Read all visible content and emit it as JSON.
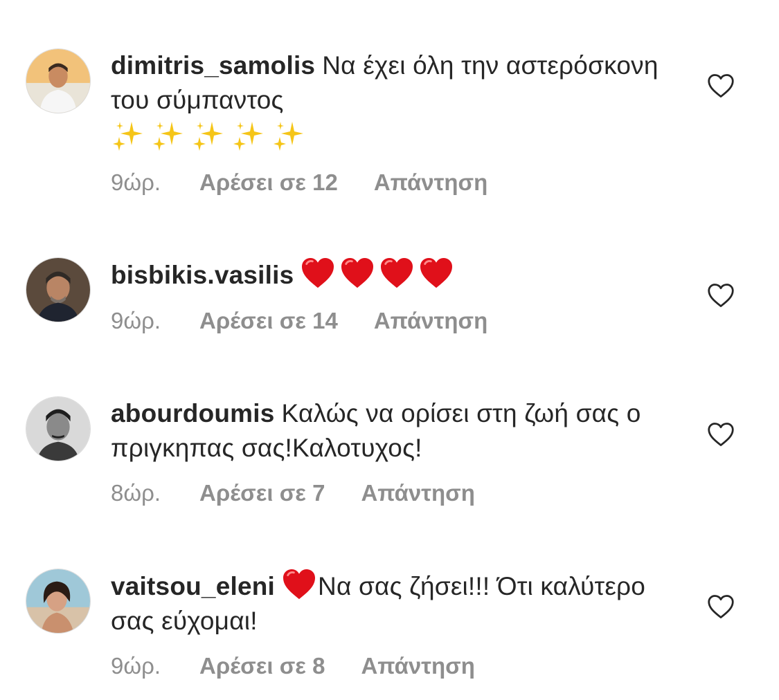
{
  "comments": [
    {
      "username": "dimitris_samolis",
      "text": "Να έχει όλη την αστερόσκονη του σύμπαντος",
      "emoji": "sparkles-emoji",
      "time": "9ώρ.",
      "likes": "Αρέσει σε 12",
      "reply": "Απάντηση"
    },
    {
      "username": "bisbikis.vasilis",
      "text": "",
      "emoji": "red-heart-emoji",
      "time": "9ώρ.",
      "likes": "Αρέσει σε 14",
      "reply": "Απάντηση"
    },
    {
      "username": "abourdoumis",
      "text": "Καλώς να ορίσει στη ζωή σας ο πριγκηπας σας!Καλοτυχος!",
      "time": "8ώρ.",
      "likes": "Αρέσει σε 7",
      "reply": "Απάντηση"
    },
    {
      "username": "vaitsou_eleni",
      "text": "Να σας ζήσει!!! Ότι καλύτερο σας εύχομαι!",
      "emoji": "red-heart-emoji",
      "time": "9ώρ.",
      "likes": "Αρέσει σε 8",
      "reply": "Απάντηση"
    }
  ],
  "icons": {
    "like": "heart-outline-icon"
  },
  "colors": {
    "username": "#262626",
    "meta": "#8e8e8e",
    "heart_emoji": "#e0101a",
    "sparkle": "#f5c518"
  }
}
